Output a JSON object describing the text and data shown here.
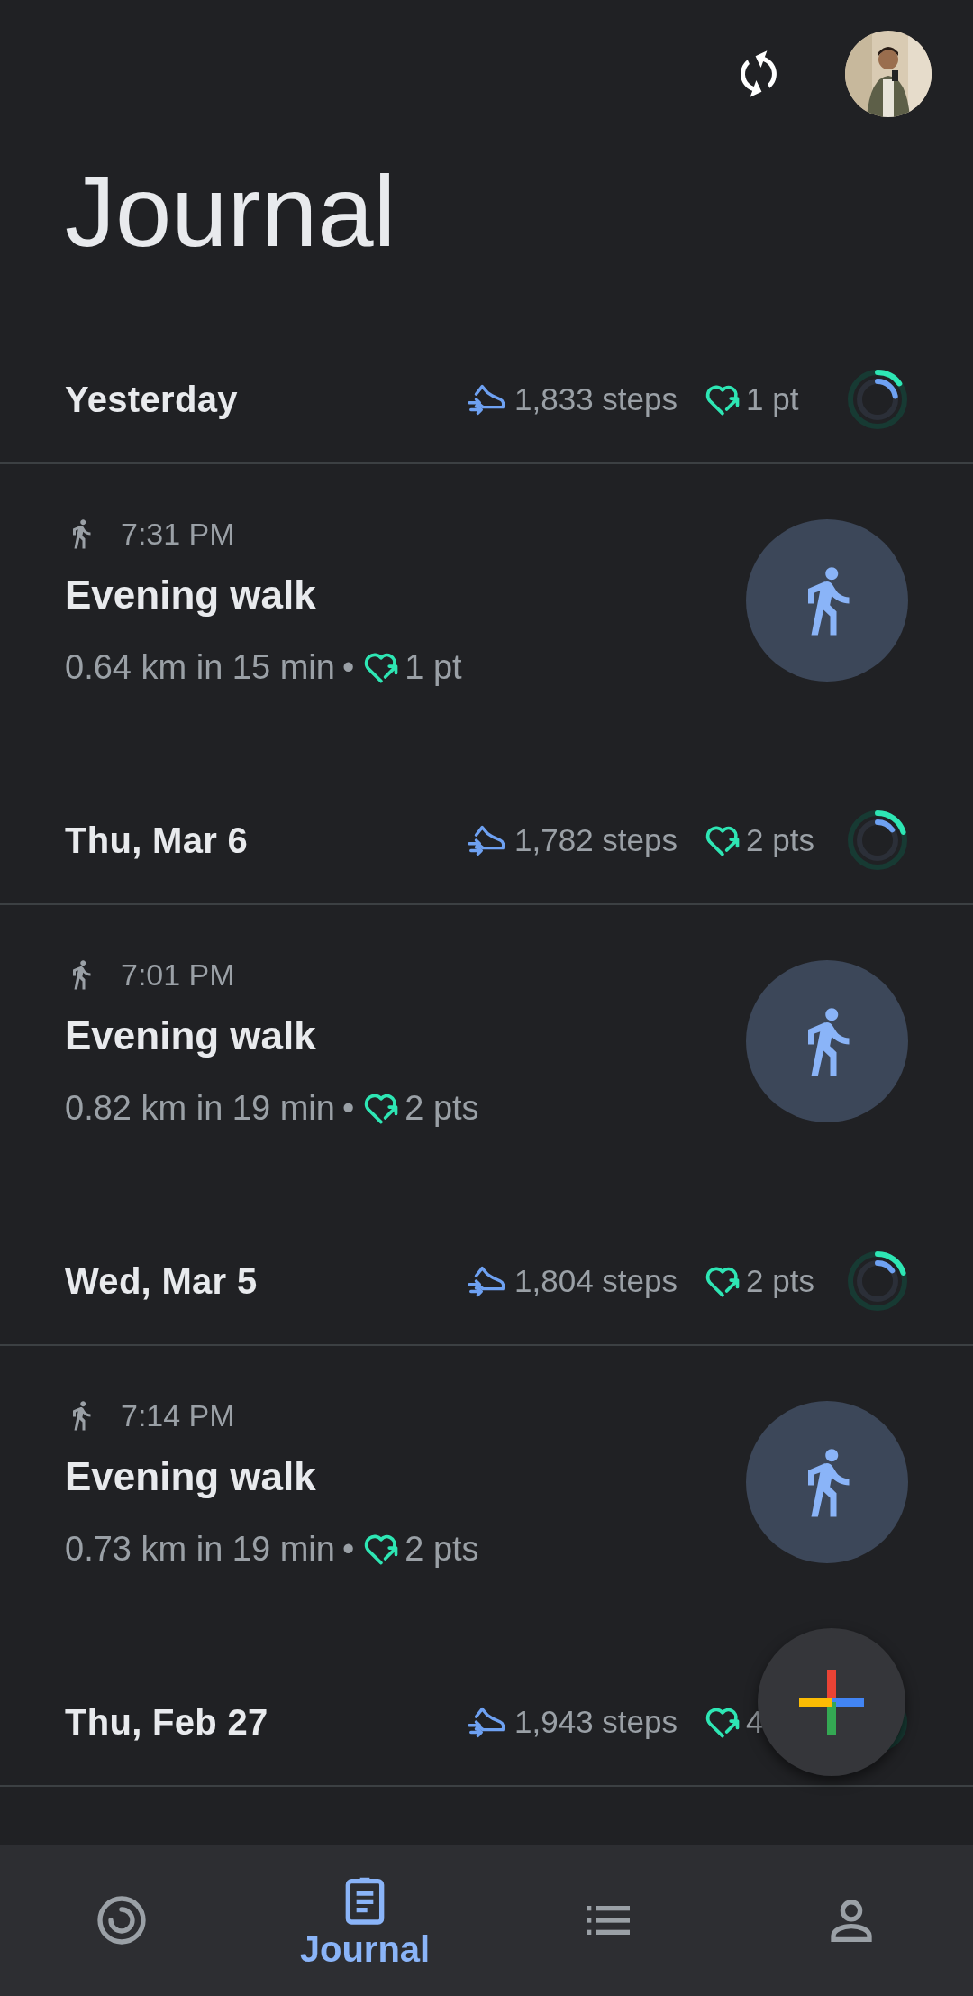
{
  "header": {
    "title": "Journal"
  },
  "days": [
    {
      "date": "Yesterday",
      "steps": "1,833 steps",
      "points": "1 pt",
      "ring": {
        "outer": {
          "level": 0.15
        },
        "inner": {
          "level": 0.22
        }
      },
      "activities": [
        {
          "kind": "walk",
          "time": "7:31 PM",
          "title": "Evening walk",
          "detail": "0.64 km in 15 min",
          "separator": "•",
          "points": "1 pt"
        }
      ]
    },
    {
      "date": "Thu, Mar 6",
      "steps": "1,782 steps",
      "points": "2 pts",
      "ring": {
        "outer": {
          "level": 0.2
        },
        "inner": {
          "level": 0.15
        }
      },
      "activities": [
        {
          "kind": "walk",
          "time": "7:01 PM",
          "title": "Evening walk",
          "detail": "0.82 km in 19 min",
          "separator": "•",
          "points": "2 pts"
        }
      ]
    },
    {
      "date": "Wed, Mar 5",
      "steps": "1,804 steps",
      "points": "2 pts",
      "ring": {
        "outer": {
          "level": 0.2
        },
        "inner": {
          "level": 0.15
        }
      },
      "activities": [
        {
          "kind": "walk",
          "time": "7:14 PM",
          "title": "Evening walk",
          "detail": "0.73 km in 19 min",
          "separator": "•",
          "points": "2 pts"
        }
      ]
    },
    {
      "date": "Thu, Feb 27",
      "steps": "1,943 steps",
      "points": "4"
    }
  ],
  "nav": [
    {
      "kind": "home",
      "selected": false
    },
    {
      "kind": "journal",
      "label": "Journal",
      "selected": true
    },
    {
      "kind": "browse",
      "selected": false
    },
    {
      "kind": "profile",
      "selected": false
    }
  ]
}
